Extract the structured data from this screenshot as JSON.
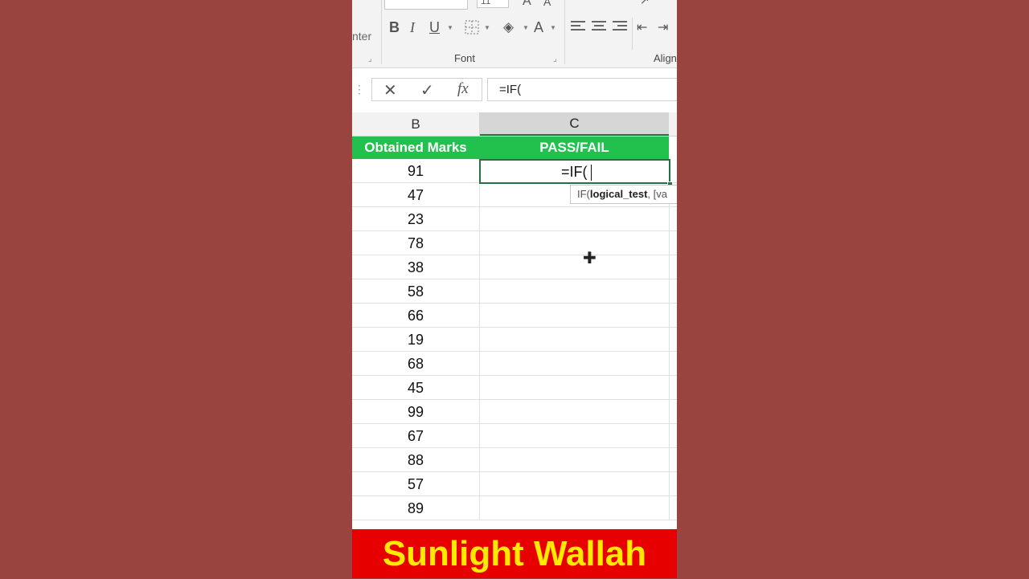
{
  "ribbon": {
    "center_fragment": "nter",
    "font_size_value": "11",
    "font_group_label": "Font",
    "align_group_label": "Align",
    "bold": "B",
    "italic": "I",
    "underline": "U",
    "font_color": "A"
  },
  "formula_bar": {
    "cancel": "✕",
    "enter": "✓",
    "fx": "fx",
    "value": "=IF("
  },
  "columns": {
    "b": "B",
    "c": "C"
  },
  "headers": {
    "b": "Obtained Marks",
    "c": "PASS/FAIL"
  },
  "marks": [
    "91",
    "47",
    "23",
    "78",
    "38",
    "58",
    "66",
    "19",
    "68",
    "45",
    "99",
    "67",
    "88",
    "57",
    "89"
  ],
  "active_cell": {
    "text": "=IF("
  },
  "tooltip": {
    "prefix": "IF(",
    "arg_bold": "logical_test",
    "rest": ", [va"
  },
  "banner": "Sunlight Wallah",
  "colors": {
    "header_green": "#22c04d",
    "banner_red": "#e60000",
    "banner_text": "#ffea00",
    "selection": "#217346"
  }
}
